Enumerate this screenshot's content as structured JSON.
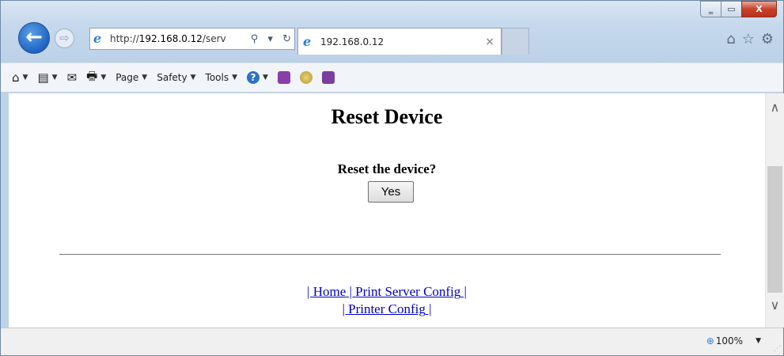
{
  "window": {
    "minimize_glyph": "‗",
    "maximize_glyph": "▭",
    "close_glyph": "X"
  },
  "nav": {
    "back_glyph": "←",
    "forward_glyph": "⇨",
    "address_prefix": "http://",
    "address_host": "192.168.0.12",
    "address_suffix": "/serv",
    "address_icons": "⚲ ▾ ↻"
  },
  "tab": {
    "title": "192.168.0.12",
    "close_glyph": "×"
  },
  "toolbar_icons": {
    "home": "⌂",
    "favorites": "☆",
    "settings": "⚙"
  },
  "command_bar": {
    "home_glyph": "⌂",
    "feeds_glyph": "▤",
    "mail_glyph": "✉",
    "print_glyph": "🖶",
    "page_label": "Page",
    "safety_label": "Safety",
    "tools_label": "Tools",
    "help_glyph": "?",
    "arrow_glyph": "▼"
  },
  "content": {
    "title": "Reset Device",
    "question": "Reset the device?",
    "yes_button": "Yes",
    "link_sep_1": "| ",
    "link_home": "Home",
    "link_sep_2": " | ",
    "link_print_server": "Print Server Config",
    "link_sep_3": " |",
    "link_sep_4": "| ",
    "link_printer": "Printer Config",
    "link_sep_5": " |"
  },
  "scrollbar": {
    "up_glyph": "∧",
    "down_glyph": "∨"
  },
  "status": {
    "zoom_icon": "⊕",
    "zoom_level": "100%",
    "zoom_arrow": "▼",
    "grip": "⋰"
  },
  "colors": {
    "link": "#0000cc",
    "frame": "#bcd3ea",
    "back_button": "#1f64c3"
  }
}
